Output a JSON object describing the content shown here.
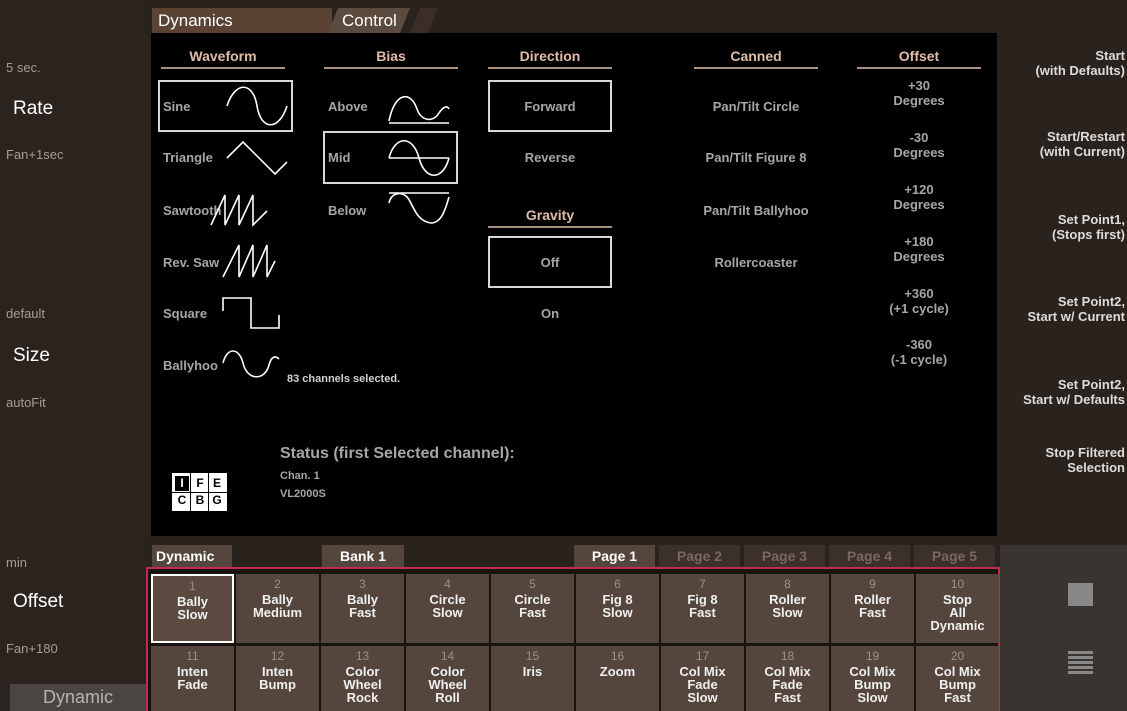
{
  "left": {
    "rate_top": "5 sec.",
    "rate_label": "Rate",
    "rate_bottom": "Fan+1sec",
    "size_top": "default",
    "size_label": "Size",
    "size_bottom": "autoFit",
    "offset_top": "min",
    "offset_label": "Offset",
    "offset_bottom": "Fan+180",
    "dynamic_button": "Dynamic"
  },
  "tabs": {
    "dynamics": "Dynamics",
    "control": "Control"
  },
  "waveform": {
    "header": "Waveform",
    "options": [
      "Sine",
      "Triangle",
      "Sawtooth",
      "Rev. Saw",
      "Square",
      "Ballyhoo"
    ]
  },
  "bias": {
    "header": "Bias",
    "options": [
      "Above",
      "Mid",
      "Below"
    ]
  },
  "direction": {
    "header": "Direction",
    "options": [
      "Forward",
      "Reverse"
    ]
  },
  "gravity": {
    "header": "Gravity",
    "options": [
      "Off",
      "On"
    ]
  },
  "canned": {
    "header": "Canned",
    "options": [
      "Pan/Tilt Circle",
      "Pan/Tilt Figure 8",
      "Pan/Tilt Ballyhoo",
      "Rollercoaster"
    ]
  },
  "offset": {
    "header": "Offset",
    "options": [
      [
        "+30",
        "Degrees"
      ],
      [
        "-30",
        "Degrees"
      ],
      [
        "+120",
        "Degrees"
      ],
      [
        "+180",
        "Degrees"
      ],
      [
        "+360",
        "(+1 cycle)"
      ],
      [
        "-360",
        "(-1 cycle)"
      ]
    ]
  },
  "selection_info": "83 channels selected.",
  "status": {
    "title": "Status (first Selected channel):",
    "chan": "Chan. 1",
    "fixture": "VL2000S",
    "flags_row1": [
      "I",
      "F",
      "E"
    ],
    "flags_row2": [
      "C",
      "B",
      "G"
    ]
  },
  "right_buttons": [
    [
      "Start",
      "(with Defaults)"
    ],
    [
      "Start/Restart",
      "(with Current)"
    ],
    [
      "Set Point1,",
      "(Stops first)"
    ],
    [
      "Set Point2,",
      "Start w/ Current"
    ],
    [
      "Set Point2,",
      "Start w/ Defaults"
    ],
    [
      "Stop Filtered",
      "Selection"
    ]
  ],
  "bottom_bar": {
    "dynamic": "Dynamic",
    "bank": "Bank 1",
    "pages": [
      "Page 1",
      "Page 2",
      "Page 3",
      "Page 4",
      "Page 5"
    ]
  },
  "grid": [
    {
      "n": "1",
      "l": [
        "Bally",
        "Slow"
      ]
    },
    {
      "n": "2",
      "l": [
        "Bally",
        "Medium"
      ]
    },
    {
      "n": "3",
      "l": [
        "Bally",
        "Fast"
      ]
    },
    {
      "n": "4",
      "l": [
        "Circle",
        "Slow"
      ]
    },
    {
      "n": "5",
      "l": [
        "Circle",
        "Fast"
      ]
    },
    {
      "n": "6",
      "l": [
        "Fig 8",
        "Slow"
      ]
    },
    {
      "n": "7",
      "l": [
        "Fig 8",
        "Fast"
      ]
    },
    {
      "n": "8",
      "l": [
        "Roller",
        "Slow"
      ]
    },
    {
      "n": "9",
      "l": [
        "Roller",
        "Fast"
      ]
    },
    {
      "n": "10",
      "l": [
        "Stop",
        "All",
        "Dynamic"
      ]
    },
    {
      "n": "11",
      "l": [
        "Inten",
        "Fade"
      ]
    },
    {
      "n": "12",
      "l": [
        "Inten",
        "Bump"
      ]
    },
    {
      "n": "13",
      "l": [
        "Color",
        "Wheel",
        "Rock"
      ]
    },
    {
      "n": "14",
      "l": [
        "Color",
        "Wheel",
        "Roll"
      ]
    },
    {
      "n": "15",
      "l": [
        "Iris"
      ]
    },
    {
      "n": "16",
      "l": [
        "Zoom"
      ]
    },
    {
      "n": "17",
      "l": [
        "Col Mix",
        "Fade",
        "Slow"
      ]
    },
    {
      "n": "18",
      "l": [
        "Col Mix",
        "Fade",
        "Fast"
      ]
    },
    {
      "n": "19",
      "l": [
        "Col Mix",
        "Bump",
        "Slow"
      ]
    },
    {
      "n": "20",
      "l": [
        "Col Mix",
        "Bump",
        "Fast"
      ]
    }
  ],
  "colors": {
    "accent_header": "#e0bca6",
    "grid_border": "#c22a55",
    "cell_bg": "#54463c"
  }
}
